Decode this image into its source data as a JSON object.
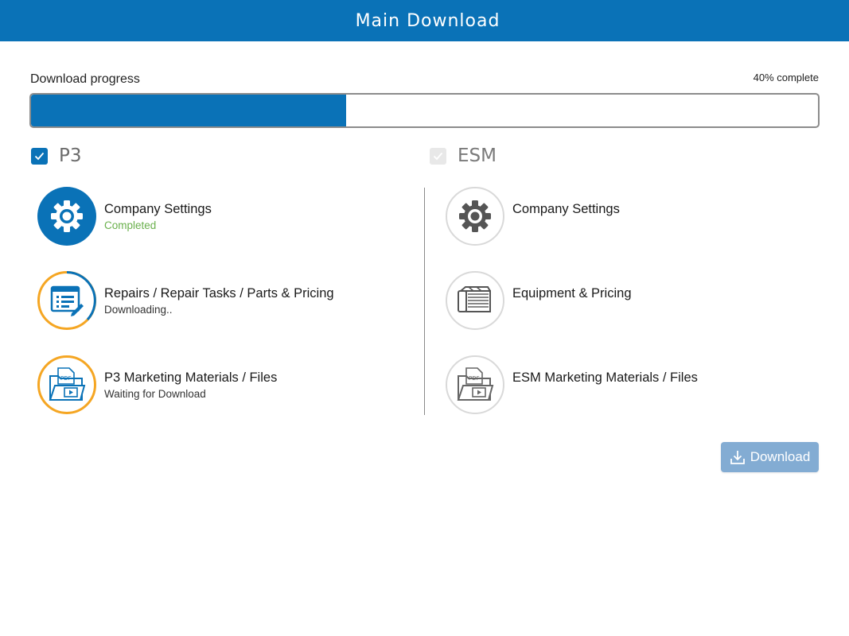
{
  "header": {
    "title": "Main Download"
  },
  "progress": {
    "label": "Download progress",
    "percent_text": "40% complete",
    "value": 0.4
  },
  "sections": {
    "p3": {
      "title": "P3",
      "checked": true,
      "items": [
        {
          "title": "Company Settings",
          "status": "Completed",
          "icon": "gear-icon"
        },
        {
          "title": "Repairs / Repair Tasks / Parts & Pricing",
          "status": "Downloading..",
          "icon": "task-list-icon"
        },
        {
          "title": "P3 Marketing Materials / Files",
          "status": "Waiting for Download",
          "icon": "pdf-folder-icon"
        }
      ]
    },
    "esm": {
      "title": "ESM",
      "checked": true,
      "disabled": true,
      "items": [
        {
          "title": "Company Settings",
          "icon": "gear-icon"
        },
        {
          "title": "Equipment & Pricing",
          "icon": "equipment-icon"
        },
        {
          "title": "ESM Marketing Materials / Files",
          "icon": "pdf-folder-icon"
        }
      ]
    }
  },
  "actions": {
    "download_label": "Download",
    "download_icon": "download-icon"
  },
  "colors": {
    "brand": "#0a72b7",
    "in_progress": "#f5a623",
    "completed": "#6ab04c",
    "button_disabled": "#83acd3"
  }
}
